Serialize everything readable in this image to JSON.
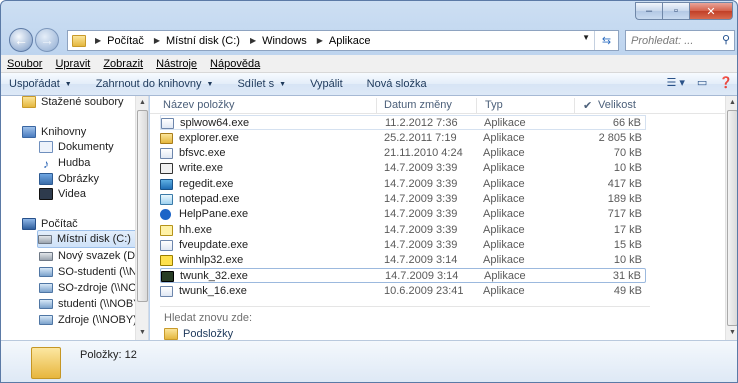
{
  "address": {
    "segments": [
      "Počítač",
      "Místní disk (C:)",
      "Windows",
      "Aplikace"
    ],
    "search_placeholder": "Prohledat: ..."
  },
  "menu": {
    "items": [
      {
        "label": "Soubor"
      },
      {
        "label": "Upravit"
      },
      {
        "label": "Zobrazit"
      },
      {
        "label": "Nástroje"
      },
      {
        "label": "Nápověda"
      }
    ]
  },
  "toolbar": {
    "organize": "Uspořádat",
    "include_library": "Zahrnout do knihovny",
    "share": "Sdílet s",
    "burn": "Vypálit",
    "new_folder": "Nová složka"
  },
  "nav": {
    "items": [
      {
        "label": "Stažené soubory",
        "icon": "downloads-icon"
      },
      {
        "label": "Knihovny",
        "icon": "libraries-icon"
      },
      {
        "label": "Dokumenty",
        "icon": "documents-icon"
      },
      {
        "label": "Hudba",
        "icon": "music-icon"
      },
      {
        "label": "Obrázky",
        "icon": "pictures-icon"
      },
      {
        "label": "Videa",
        "icon": "videos-icon"
      },
      {
        "label": "Počítač",
        "icon": "computer-icon"
      },
      {
        "label": "Místní disk (C:)",
        "icon": "drive-icon"
      },
      {
        "label": "Nový svazek (D:)",
        "icon": "drive-icon"
      },
      {
        "label": "SO-studenti (\\\\N",
        "icon": "network-drive-icon"
      },
      {
        "label": "SO-zdroje (\\\\NOI",
        "icon": "network-drive-icon"
      },
      {
        "label": "studenti (\\\\NOBY",
        "icon": "network-drive-icon"
      },
      {
        "label": "Zdroje (\\\\NOBY)",
        "icon": "network-drive-icon"
      }
    ]
  },
  "columns": {
    "name": "Název položky",
    "date": "Datum změny",
    "type": "Typ",
    "size": "Velikost"
  },
  "files": [
    {
      "name": "splwow64.exe",
      "date": "11.2.2012 7:36",
      "type": "Aplikace",
      "size": "66 kB",
      "icon": "app-icon"
    },
    {
      "name": "explorer.exe",
      "date": "25.2.2011 7:19",
      "type": "Aplikace",
      "size": "2 805 kB",
      "icon": "explorer-icon"
    },
    {
      "name": "bfsvc.exe",
      "date": "21.11.2010 4:24",
      "type": "Aplikace",
      "size": "70 kB",
      "icon": "app-icon"
    },
    {
      "name": "write.exe",
      "date": "14.7.2009 3:39",
      "type": "Aplikace",
      "size": "10 kB",
      "icon": "write-icon"
    },
    {
      "name": "regedit.exe",
      "date": "14.7.2009 3:39",
      "type": "Aplikace",
      "size": "417 kB",
      "icon": "regedit-icon"
    },
    {
      "name": "notepad.exe",
      "date": "14.7.2009 3:39",
      "type": "Aplikace",
      "size": "189 kB",
      "icon": "notepad-icon"
    },
    {
      "name": "HelpPane.exe",
      "date": "14.7.2009 3:39",
      "type": "Aplikace",
      "size": "717 kB",
      "icon": "help-icon"
    },
    {
      "name": "hh.exe",
      "date": "14.7.2009 3:39",
      "type": "Aplikace",
      "size": "17 kB",
      "icon": "hh-icon"
    },
    {
      "name": "fveupdate.exe",
      "date": "14.7.2009 3:39",
      "type": "Aplikace",
      "size": "15 kB",
      "icon": "app-icon"
    },
    {
      "name": "winhlp32.exe",
      "date": "14.7.2009 3:14",
      "type": "Aplikace",
      "size": "10 kB",
      "icon": "winhlp-icon"
    },
    {
      "name": "twunk_32.exe",
      "date": "14.7.2009 3:14",
      "type": "Aplikace",
      "size": "31 kB",
      "icon": "twunk-icon"
    },
    {
      "name": "twunk_16.exe",
      "date": "10.6.2009 23:41",
      "type": "Aplikace",
      "size": "49 kB",
      "icon": "app-icon"
    }
  ],
  "search_again": "Hledat znovu zde:",
  "subfolders": "Podsložky",
  "status": {
    "count": "Položky: 12"
  }
}
